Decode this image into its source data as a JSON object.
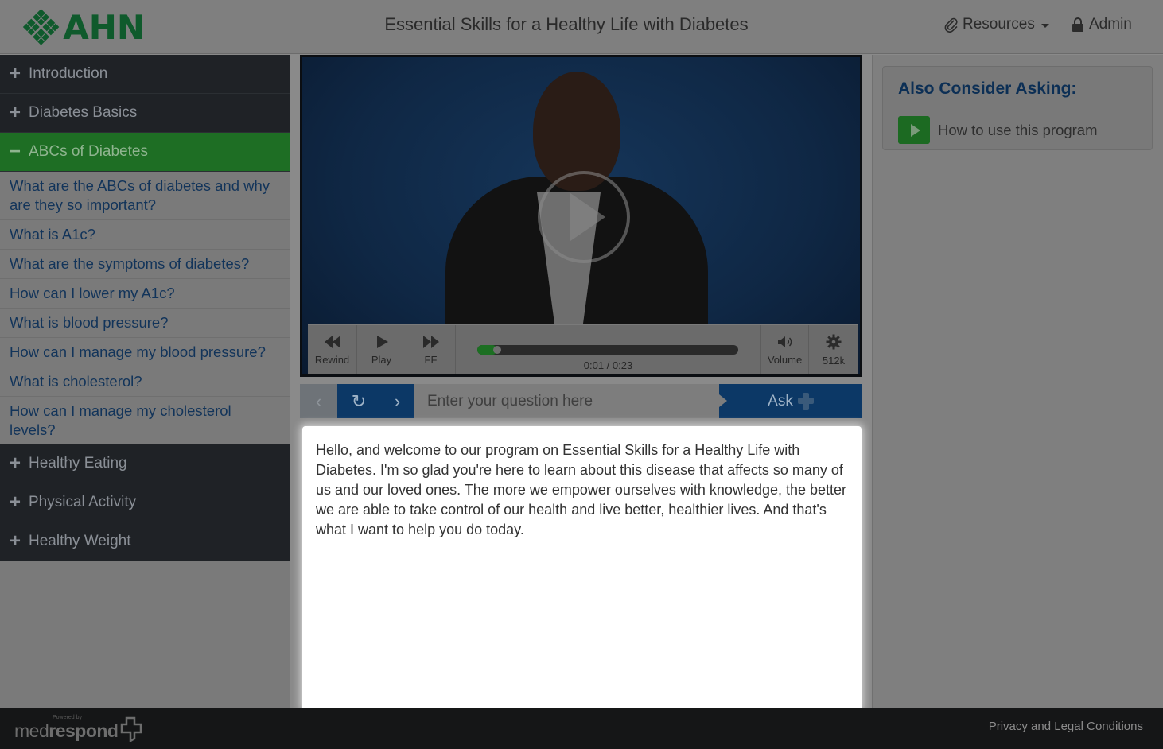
{
  "header": {
    "logo_text": "AHN",
    "title": "Essential Skills for a Healthy Life with Diabetes",
    "resources_label": "Resources",
    "admin_label": "Admin"
  },
  "sidebar": {
    "sections": [
      {
        "label": "Introduction",
        "expanded": false
      },
      {
        "label": "Diabetes Basics",
        "expanded": false
      },
      {
        "label": "ABCs of Diabetes",
        "expanded": true
      },
      {
        "label": "Healthy Eating",
        "expanded": false
      },
      {
        "label": "Physical Activity",
        "expanded": false
      },
      {
        "label": "Healthy Weight",
        "expanded": false
      }
    ],
    "abc_items": [
      "What are the ABCs of diabetes and why are they so important?",
      "What is A1c?",
      "What are the symptoms of diabetes?",
      "How can I lower my A1c?",
      "What is blood pressure?",
      "How can I manage my blood pressure?",
      "What is cholesterol?",
      "How can I manage my cholesterol levels?"
    ],
    "plus_glyph": "+",
    "minus_glyph": "−"
  },
  "player": {
    "rewind_label": "Rewind",
    "play_label": "Play",
    "ff_label": "FF",
    "volume_label": "Volume",
    "quality_label": "512k",
    "time": "0:01 / 0:23",
    "progress": 0.075
  },
  "askbar": {
    "placeholder": "Enter your question here",
    "ask_label": "Ask"
  },
  "transcript": {
    "text": "Hello, and welcome to our program on Essential Skills for a Healthy Life with Diabetes. I'm so glad you're here to learn about this disease that affects so many of us and our loved ones. The more we empower ourselves with knowledge, the better we are able to take control of our health and live better, healthier lives. And that's what I want to help you do today."
  },
  "right": {
    "title": "Also Consider Asking:",
    "item": "How to use this program"
  },
  "footer": {
    "powered": "Powered by",
    "brand_a": "med",
    "brand_b": "respond",
    "privacy": "Privacy and Legal Conditions"
  },
  "colors": {
    "brand_green": "#1e6e24",
    "brand_blue": "#0c3866",
    "sidebar_dark": "#1f2226"
  },
  "icons": {
    "resources": "paperclip-icon",
    "admin": "lock-icon",
    "rewind": "rewind-icon",
    "play": "play-icon",
    "ff": "fast-forward-icon",
    "volume": "volume-icon",
    "quality": "gear-icon",
    "prev": "chevron-left-icon",
    "replay": "refresh-icon",
    "next": "chevron-right-icon"
  }
}
